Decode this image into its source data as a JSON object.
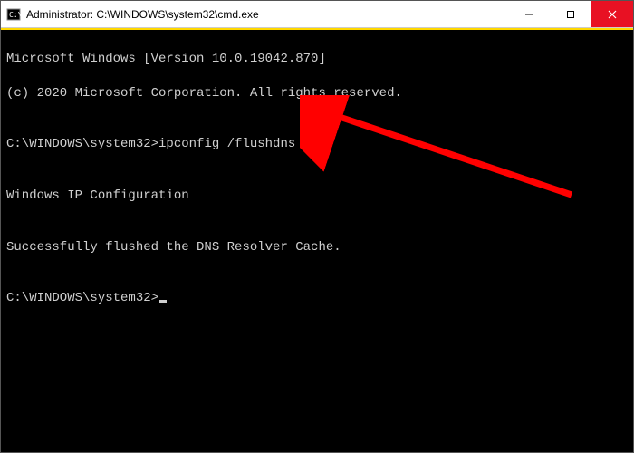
{
  "titlebar": {
    "title": "Administrator: C:\\WINDOWS\\system32\\cmd.exe"
  },
  "terminal": {
    "line1": "Microsoft Windows [Version 10.0.19042.870]",
    "line2": "(c) 2020 Microsoft Corporation. All rights reserved.",
    "blank1": "",
    "prompt1_path": "C:\\WINDOWS\\system32>",
    "prompt1_cmd": "ipconfig /flushdns",
    "blank2": "",
    "result_header": "Windows IP Configuration",
    "blank3": "",
    "result_msg": "Successfully flushed the DNS Resolver Cache.",
    "blank4": "",
    "prompt2_path": "C:\\WINDOWS\\system32>"
  }
}
